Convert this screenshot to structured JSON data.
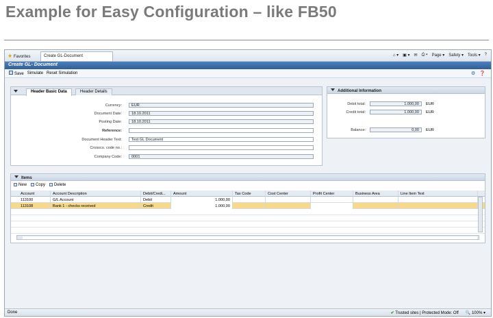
{
  "slide": {
    "title": "Example for Easy Configuration – like FB50"
  },
  "browser": {
    "favorites": "Favorites",
    "tab_title": "Create GL-Document",
    "tools": [
      "Page ▾",
      "Safety ▾",
      "Tools ▾",
      "?"
    ]
  },
  "app": {
    "title": "Create GL- Document",
    "toolbar": {
      "save": "Save",
      "simulate": "Simulate",
      "reset": "Reset Simulation"
    }
  },
  "header": {
    "tabs": [
      "Header Basic Data",
      "Header Details"
    ],
    "fields": [
      {
        "label": "Currency:",
        "value": "EUR"
      },
      {
        "label": "Document Date:",
        "value": "18.10.2011"
      },
      {
        "label": "Posting Date:",
        "value": "18.10.2011"
      },
      {
        "label": "Reference:",
        "value": ""
      },
      {
        "label": "Document Header Text:",
        "value": "Test GL Document"
      },
      {
        "label": "Crossco. code no.:",
        "value": ""
      },
      {
        "label": "Company Code:",
        "value": "0001"
      }
    ]
  },
  "additional": {
    "title": "Additional Information",
    "debit_label": "Debit total:",
    "debit_value": "1.000,00",
    "debit_cur": "EUR",
    "credit_label": "Credit total:",
    "credit_value": "1.000,00",
    "credit_cur": "EUR",
    "balance_label": "Balance:",
    "balance_value": "0,00",
    "balance_cur": "EUR"
  },
  "items": {
    "title": "Items",
    "tools": {
      "new": "New",
      "copy": "Copy",
      "delete": "Delete"
    },
    "columns": [
      "Account",
      "Account Description",
      "Debit/Credi...",
      "Amount",
      "Tax Code",
      "Cost Center",
      "Profit Center",
      "Business Area",
      "Line Item Text"
    ],
    "rows": [
      {
        "account": "113100",
        "desc": "G/L Account",
        "dc": "Debit",
        "amount": "1.000,00"
      },
      {
        "account": "113108",
        "desc": "Bank 1 - checks received",
        "dc": "Credit",
        "amount": "1.000,00"
      }
    ]
  },
  "status": {
    "left": "Done",
    "trusted": "Trusted sites | Protected Mode: Off",
    "zoom": "100%"
  }
}
